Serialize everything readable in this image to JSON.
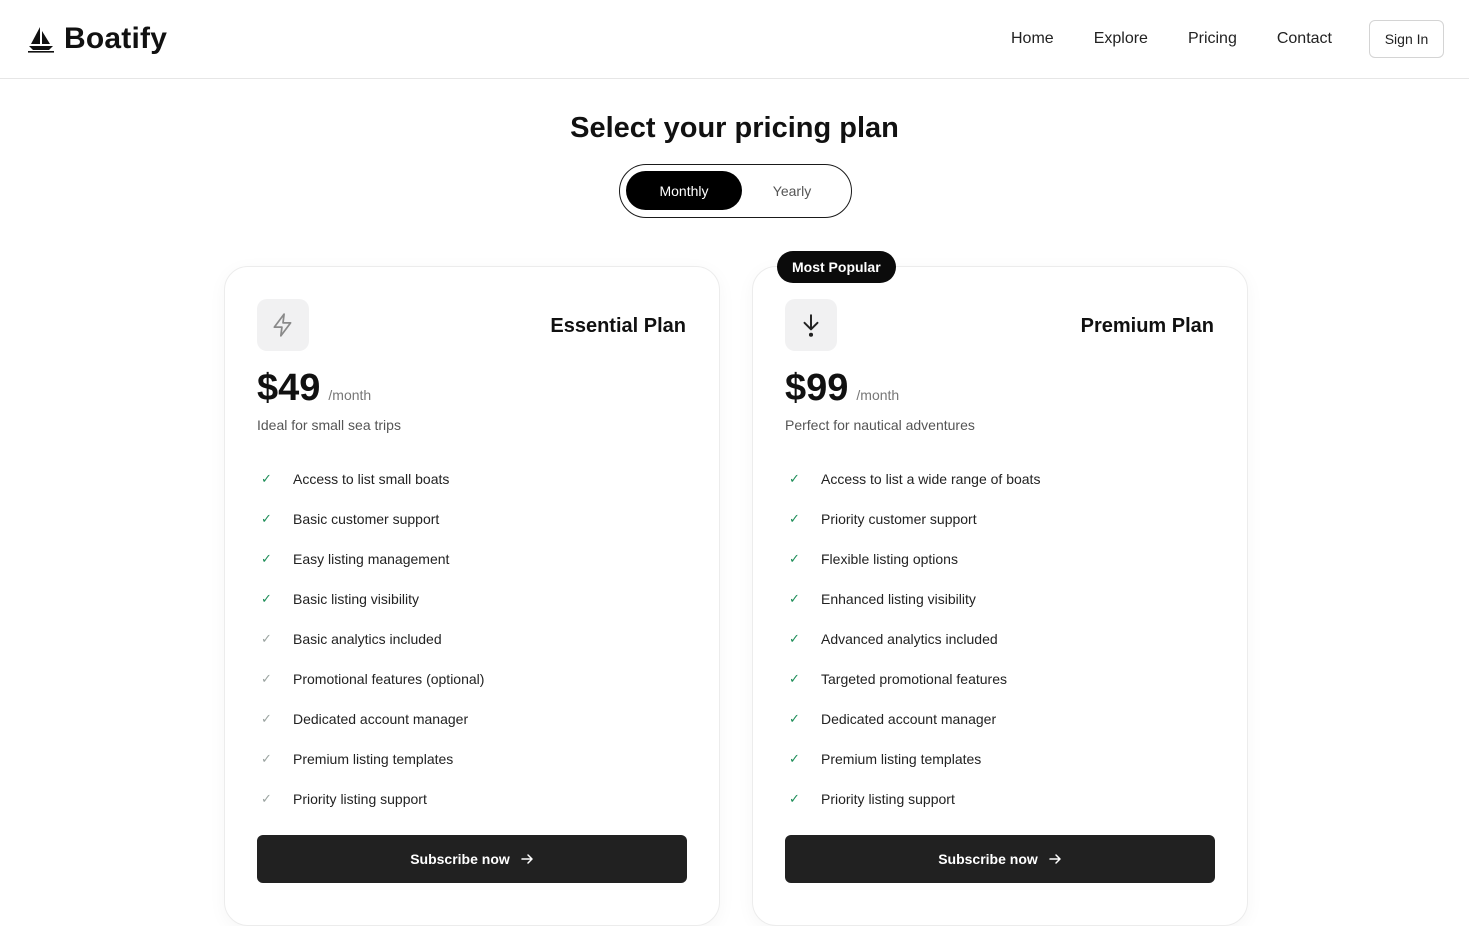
{
  "brand": {
    "name": "Boatify",
    "icon": "sailboat-icon"
  },
  "nav": {
    "links": [
      "Home",
      "Explore",
      "Pricing",
      "Contact"
    ],
    "signin_label": "Sign In"
  },
  "title": "Select your pricing plan",
  "billing_toggle": {
    "options": [
      "Monthly",
      "Yearly"
    ],
    "selected": "Monthly"
  },
  "plans": [
    {
      "name": "Essential Plan",
      "icon": "lightning-icon",
      "price": "$49",
      "period": "/month",
      "tagline": "Ideal for small sea trips",
      "features": [
        "Access to list small boats",
        "Basic customer support",
        "Easy listing management",
        "Basic listing visibility",
        "Basic analytics included",
        "Promotional features (optional)",
        "Dedicated account manager",
        "Premium listing templates",
        "Priority listing support"
      ],
      "button_label": "Subscribe now"
    },
    {
      "name": "Premium Plan",
      "icon": "arrow-down-icon",
      "badge": "Most Popular",
      "price": "$99",
      "period": "/month",
      "tagline": "Perfect for nautical adventures",
      "features": [
        "Access to list a wide range of boats",
        "Priority customer support",
        "Flexible listing options",
        "Enhanced listing visibility",
        "Advanced analytics included",
        "Targeted promotional features",
        "Dedicated account manager",
        "Premium listing templates",
        "Priority listing support"
      ],
      "button_label": "Subscribe now"
    }
  ],
  "colors": {
    "check": "#1c8d57",
    "primary_dark": "#212121",
    "badge": "#0b0b0b"
  }
}
